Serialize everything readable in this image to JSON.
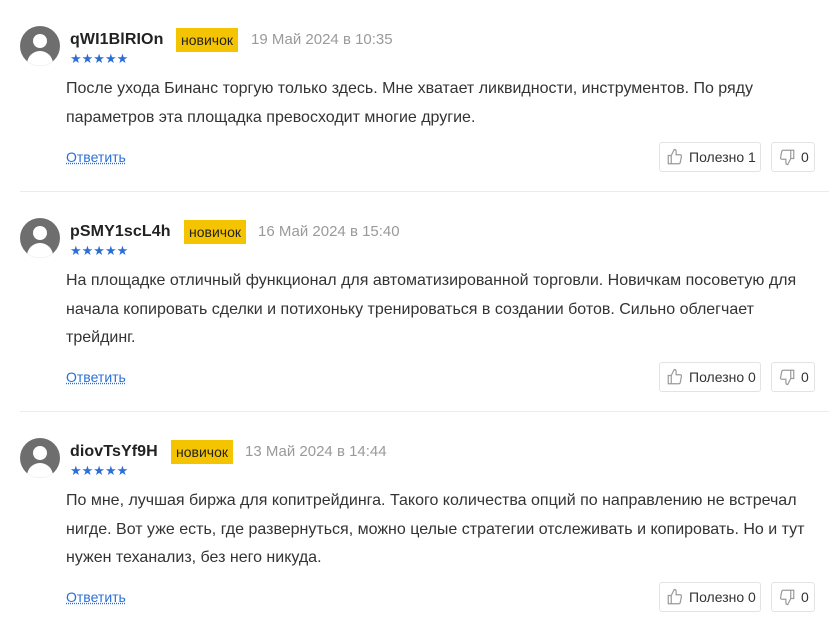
{
  "reviews": [
    {
      "username": "qWI1BlRIOn",
      "badge": "новичок",
      "date": "19 Май 2024 в 10:35",
      "rating": 5,
      "stars": "★★★★★",
      "text": "После ухода Бинанс торгую только здесь. Мне хватает ликвидности, инструментов. По ряду параметров эта площадка превосходит многие другие.",
      "reply_label": "Ответить",
      "like_label": "Полезно",
      "likes": "1",
      "dislikes": "0"
    },
    {
      "username": "pSMY1scL4h",
      "badge": "новичок",
      "date": "16 Май 2024 в 15:40",
      "rating": 5,
      "stars": "★★★★★",
      "text": "На площадке отличный функционал для автоматизированной торговли. Новичкам посоветую для начала копировать сделки и потихоньку тренироваться в создании ботов. Сильно облегчает трейдинг.",
      "reply_label": "Ответить",
      "like_label": "Полезно",
      "likes": "0",
      "dislikes": "0"
    },
    {
      "username": "diovTsYf9H",
      "badge": "новичок",
      "date": "13 Май 2024 в 14:44",
      "rating": 5,
      "stars": "★★★★★",
      "text": "По мне, лучшая биржа для копитрейдинга. Такого количества опций по направлению не встречал нигде. Вот уже есть, где развернуться, можно целые стратегии отслеживать и копировать. Но и тут нужен теханализ, без него никуда.",
      "reply_label": "Ответить",
      "like_label": "Полезно",
      "likes": "0",
      "dislikes": "0"
    }
  ],
  "colors": {
    "badge": "#f5c400",
    "stars": "#2b6fd6",
    "link": "#2b6fd6",
    "avatar": "#6e6e6e"
  }
}
